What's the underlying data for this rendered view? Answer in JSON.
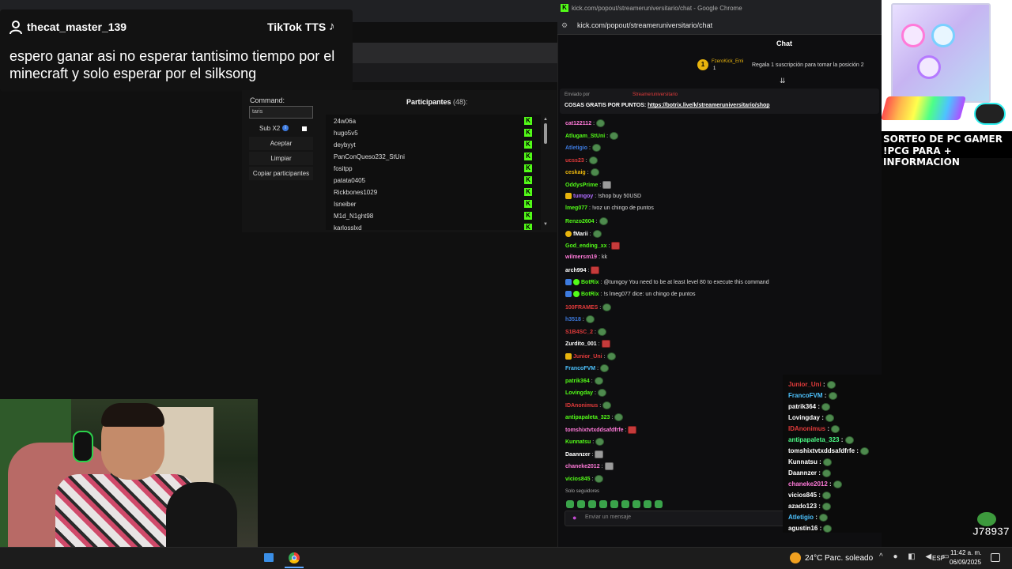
{
  "tts": {
    "username": "thecat_master_139",
    "service": "TikTok TTS",
    "message": "espero ganar asi no esperar tantisimo tiempo por el minecraft y solo esperar por el silksong"
  },
  "participants_panel": {
    "command_label": "Command:",
    "command_value": "taris",
    "sub_label": "Sub X2",
    "sub_checked": true,
    "buttons": [
      "Aceptar",
      "Limpiar",
      "Copiar participantes"
    ],
    "title": "Participantes",
    "count": "(48):",
    "participants": [
      "24w06a",
      "hugo5v5",
      "deybyyt",
      "PanConQueso232_StUni",
      "fositpp",
      "patata0405",
      "Rickbones1029",
      "Isneiber",
      "M1d_N1ght98",
      "karlosslxd"
    ]
  },
  "chat_window": {
    "window_title": "kick.com/popout/streameruniversitario/chat - Google Chrome",
    "url": "kick.com/popout/streameruniversitario/chat",
    "title": "Chat",
    "gift": {
      "user": "FzeroKick_Emi",
      "count": "1",
      "text": "Regala 1 suscripción para tomar la posición 2"
    },
    "pinned": {
      "by_label": "Enviado por",
      "user": "Streameruniversitario",
      "text": "COSAS GRATIS POR PUNTOS:",
      "link": "https://botrix.live/k/streameruniversitario/shop"
    },
    "messages": [
      {
        "user": "cat122112",
        "color": "#ff7ad9",
        "text": ""
      },
      {
        "user": "Atlugam_StUni",
        "color": "#53fc18",
        "text": ""
      },
      {
        "user": "Atletigio",
        "color": "#3d7be0",
        "text": ""
      },
      {
        "user": "ucss23",
        "color": "#e23b3b",
        "text": ""
      },
      {
        "user": "ceskaig",
        "color": "#e8b40d",
        "text": ""
      },
      {
        "user": "OddysPrime",
        "color": "#53fc18",
        "text": ""
      },
      {
        "user": "tumgoy",
        "color": "#b06cff",
        "text": "!shop buy 50USD"
      },
      {
        "user": "lmeg077",
        "color": "#53fc18",
        "text": "!voz un chingo de puntos"
      },
      {
        "user": "Renzo2604",
        "color": "#53fc18",
        "text": ""
      },
      {
        "user": "fMarii",
        "color": "#ffffff",
        "text": ""
      },
      {
        "user": "God_ending_xx",
        "color": "#53fc18",
        "text": ""
      },
      {
        "user": "wilmersm19",
        "color": "#ff7ad9",
        "text": "kk"
      },
      {
        "user": "arch994",
        "color": "#ffffff",
        "text": ""
      },
      {
        "user": "BotRix",
        "color": "#53fc18",
        "text": "@tumgoy You need to be at least level 80 to execute this command"
      },
      {
        "user": "BotRix",
        "color": "#53fc18",
        "text": "!s lmeg077 dice: un chingo de puntos"
      },
      {
        "user": "100FRAMES",
        "color": "#e23b3b",
        "text": ""
      },
      {
        "user": "h3518",
        "color": "#3d7be0",
        "text": ""
      },
      {
        "user": "S1B4SC_2",
        "color": "#e23b3b",
        "text": ""
      },
      {
        "user": "Zurdito_001",
        "color": "#ffffff",
        "text": ""
      },
      {
        "user": "Junior_Uni",
        "color": "#e23b3b",
        "text": ""
      },
      {
        "user": "FrancoFVM",
        "color": "#4dc3ff",
        "text": ""
      },
      {
        "user": "patrik364",
        "color": "#53fc18",
        "text": ""
      },
      {
        "user": "Lovingday",
        "color": "#53fc18",
        "text": ""
      },
      {
        "user": "IDAnonimus",
        "color": "#e23b3b",
        "text": ""
      },
      {
        "user": "antipapaleta_323",
        "color": "#53fc18",
        "text": ""
      },
      {
        "user": "tomshixtvtxddsafdfrfe",
        "color": "#ff7ad9",
        "text": ""
      },
      {
        "user": "Kunnatsu",
        "color": "#53fc18",
        "text": ""
      },
      {
        "user": "Daannzer",
        "color": "#ffffff",
        "text": ""
      },
      {
        "user": "chaneke2012",
        "color": "#ff7ad9",
        "text": ""
      },
      {
        "user": "vicios845",
        "color": "#53fc18",
        "text": ""
      }
    ],
    "followers_only": "Solo seguidores",
    "input_placeholder": "Enviar un mensaje"
  },
  "overlay_chat": [
    {
      "user": "Junior_Uni",
      "color": "#e23b3b"
    },
    {
      "user": "FrancoFVM",
      "color": "#4dc3ff"
    },
    {
      "user": "patrik364",
      "color": "#ffffff"
    },
    {
      "user": "Lovingday",
      "color": "#ffffff"
    },
    {
      "user": "IDAnonimus",
      "color": "#e23b3b"
    },
    {
      "user": "antipapaleta_323",
      "color": "#4dff88"
    },
    {
      "user": "tomshixtvtxddsafdfrfe",
      "color": "#ffffff"
    },
    {
      "user": "Kunnatsu",
      "color": "#ffffff"
    },
    {
      "user": "Daannzer",
      "color": "#ffffff"
    },
    {
      "user": "chaneke2012",
      "color": "#ff7ad9"
    },
    {
      "user": "vicios845",
      "color": "#ffffff"
    },
    {
      "user": "azado123",
      "color": "#ffffff"
    },
    {
      "user": "Atletigio",
      "color": "#4dc3ff"
    },
    {
      "user": "agustin16",
      "color": "#ffffff"
    }
  ],
  "overlay_badge": "J78937",
  "ad": {
    "line1": "SORTEO DE PC GAMER",
    "line2": "!PCG PARA + INFORMACION"
  },
  "taskbar": {
    "temperature": "24°C",
    "weather": "Parc. soleado",
    "lang": "ESP",
    "time": "11:42 a. m.",
    "date": "06/09/2025"
  },
  "colors": {
    "kick_green": "#53fc18",
    "background": "#0e0e10"
  }
}
